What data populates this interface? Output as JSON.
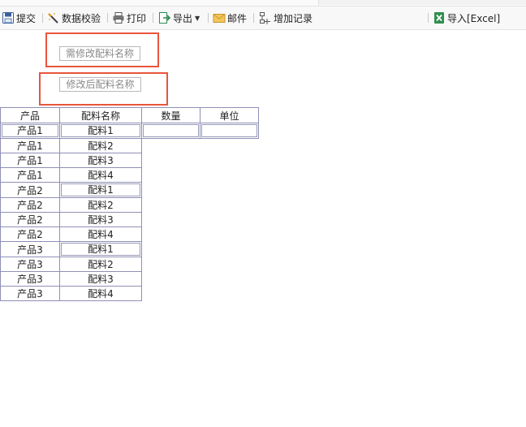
{
  "toolbar": {
    "submit": "提交",
    "validate": "数据校验",
    "print": "打印",
    "export": "导出",
    "mail": "邮件",
    "add_record": "增加记录",
    "import_excel": "导入[Excel]"
  },
  "form": {
    "material_to_change_placeholder": "需修改配料名称",
    "material_after_change_placeholder": "修改后配料名称"
  },
  "table": {
    "headers": [
      "产品",
      "配料名称",
      "数量",
      "单位"
    ],
    "rows": [
      {
        "product": "产品1",
        "material": "配料1"
      },
      {
        "product": "产品1",
        "material": "配料2"
      },
      {
        "product": "产品1",
        "material": "配料3"
      },
      {
        "product": "产品1",
        "material": "配料4"
      },
      {
        "product": "产品2",
        "material": "配料1"
      },
      {
        "product": "产品2",
        "material": "配料2"
      },
      {
        "product": "产品2",
        "material": "配料3"
      },
      {
        "product": "产品2",
        "material": "配料4"
      },
      {
        "product": "产品3",
        "material": "配料1"
      },
      {
        "product": "产品3",
        "material": "配料2"
      },
      {
        "product": "产品3",
        "material": "配料3"
      },
      {
        "product": "产品3",
        "material": "配料4"
      }
    ]
  },
  "colors": {
    "highlight_border": "#e8553b",
    "grid_border": "#8f8fb8"
  }
}
